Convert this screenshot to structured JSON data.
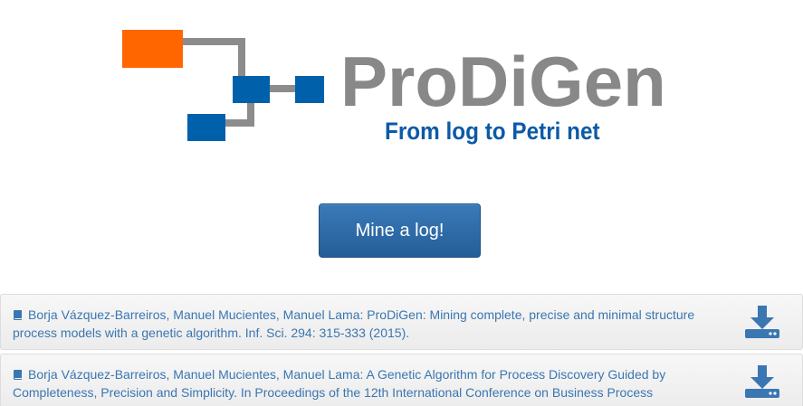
{
  "logo": {
    "title": "ProDiGen",
    "subtitle": "From log to Petri net",
    "colors": {
      "orange": "#ff6600",
      "blue": "#0060aa",
      "gray": "#888888",
      "subtitle_blue": "#0c5aa6"
    }
  },
  "actions": {
    "mine_label": "Mine a log!"
  },
  "publications": [
    {
      "icon": "book-icon",
      "text": "Borja Vázquez-Barreiros, Manuel Mucientes, Manuel Lama: ProDiGen: Mining complete, precise and minimal structure process models with a genetic algorithm. Inf. Sci. 294: 315-333 (2015).",
      "download_icon": "download-icon"
    },
    {
      "icon": "book-icon",
      "text": "Borja Vázquez-Barreiros, Manuel Mucientes, Manuel Lama: A Genetic Algorithm for Process Discovery Guided by Completeness, Precision and Simplicity. In Proceedings of the 12th International Conference on Business Process",
      "download_icon": "download-icon"
    }
  ]
}
